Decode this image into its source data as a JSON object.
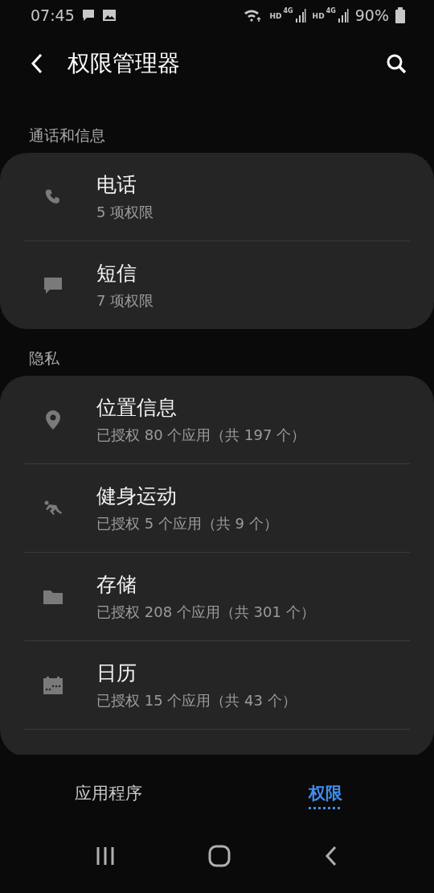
{
  "status_bar": {
    "time": "07:45",
    "sims": [
      {
        "hd": "HD",
        "net": "4G"
      },
      {
        "hd": "HD",
        "net": "4G"
      }
    ],
    "battery": "90%"
  },
  "app_bar": {
    "title": "权限管理器"
  },
  "groups": [
    {
      "header": "通话和信息",
      "continues": false,
      "items": [
        {
          "kind": "phone",
          "title": "电话",
          "subtitle": "5 项权限"
        },
        {
          "kind": "message",
          "title": "短信",
          "subtitle": "7 项权限"
        }
      ]
    },
    {
      "header": "隐私",
      "continues": true,
      "items": [
        {
          "kind": "location",
          "title": "位置信息",
          "subtitle": "已授权 80 个应用（共 197 个）"
        },
        {
          "kind": "fitness",
          "title": "健身运动",
          "subtitle": "已授权 5 个应用（共 9 个）"
        },
        {
          "kind": "folder",
          "title": "存储",
          "subtitle": "已授权 208 个应用（共 301 个）"
        },
        {
          "kind": "calendar",
          "title": "日历",
          "subtitle": "已授权 15 个应用（共 43 个）"
        }
      ]
    }
  ],
  "tabs": [
    {
      "label": "应用程序",
      "selected": false
    },
    {
      "label": "权限",
      "selected": true
    }
  ]
}
